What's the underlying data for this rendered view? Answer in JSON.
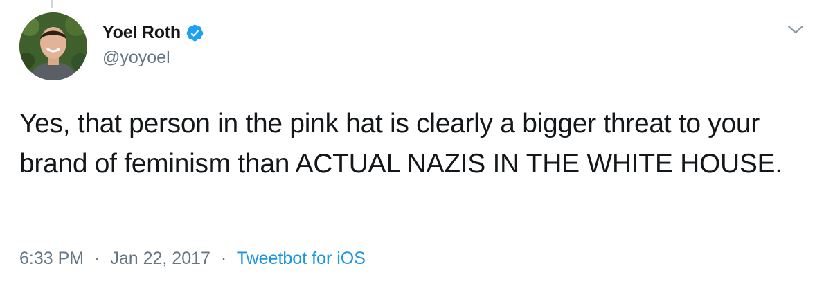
{
  "tweet": {
    "author": {
      "display_name": "Yoel Roth",
      "handle": "@yoyoel",
      "verified": true
    },
    "text": "Yes, that person in the pink hat is clearly a bigger threat to your brand of feminism than ACTUAL NAZIS IN THE WHITE HOUSE.",
    "time": "6:33 PM",
    "separator": "·",
    "date": "Jan 22, 2017",
    "source": "Tweetbot for iOS"
  },
  "icons": {
    "verified": "verified-badge-icon",
    "menu": "chevron-down-icon"
  },
  "colors": {
    "verified_blue": "#1da1f2",
    "link_blue": "#1b95e0",
    "secondary_text": "#657786",
    "primary_text": "#14171a",
    "thread_line": "#ccd6dd"
  }
}
